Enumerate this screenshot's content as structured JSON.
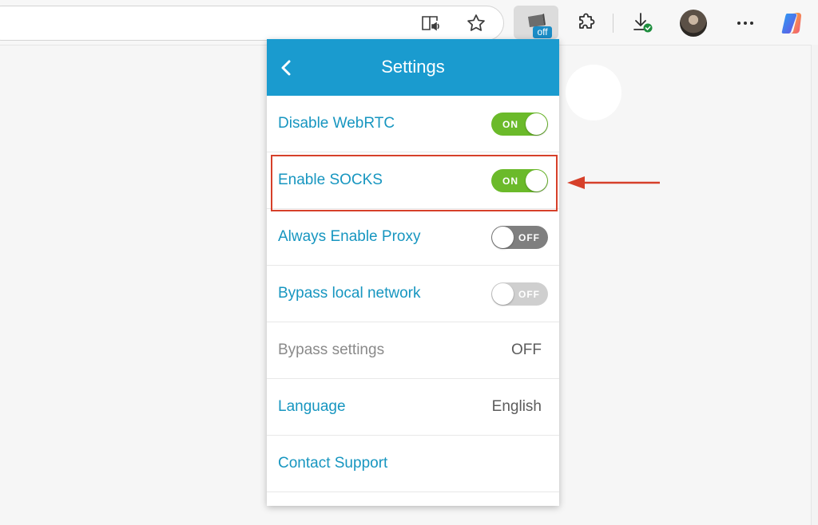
{
  "toolbar": {
    "extension_badge": "off",
    "icons": [
      "reader-view-icon",
      "favorite-star-icon",
      "extension-proxy-icon",
      "extensions-puzzle-icon",
      "downloads-icon",
      "profile-avatar",
      "more-options-icon",
      "copilot-icon"
    ]
  },
  "popup": {
    "title": "Settings",
    "rows": [
      {
        "label": "Disable WebRTC",
        "type": "toggle",
        "state": "ON"
      },
      {
        "label": "Enable SOCKS",
        "type": "toggle",
        "state": "ON"
      },
      {
        "label": "Always Enable Proxy",
        "type": "toggle",
        "state": "OFF"
      },
      {
        "label": "Bypass local network",
        "type": "toggle",
        "state": "OFF"
      },
      {
        "label": "Bypass settings",
        "type": "value",
        "value": "OFF"
      },
      {
        "label": "Language",
        "type": "value",
        "value": "English"
      },
      {
        "label": "Contact Support",
        "type": "link"
      }
    ]
  },
  "colors": {
    "header": "#1a9bcf",
    "label": "#1796c0",
    "toggle_on": "#6bba2a",
    "toggle_off": "#7f7f7f",
    "highlight": "#d6402a"
  }
}
